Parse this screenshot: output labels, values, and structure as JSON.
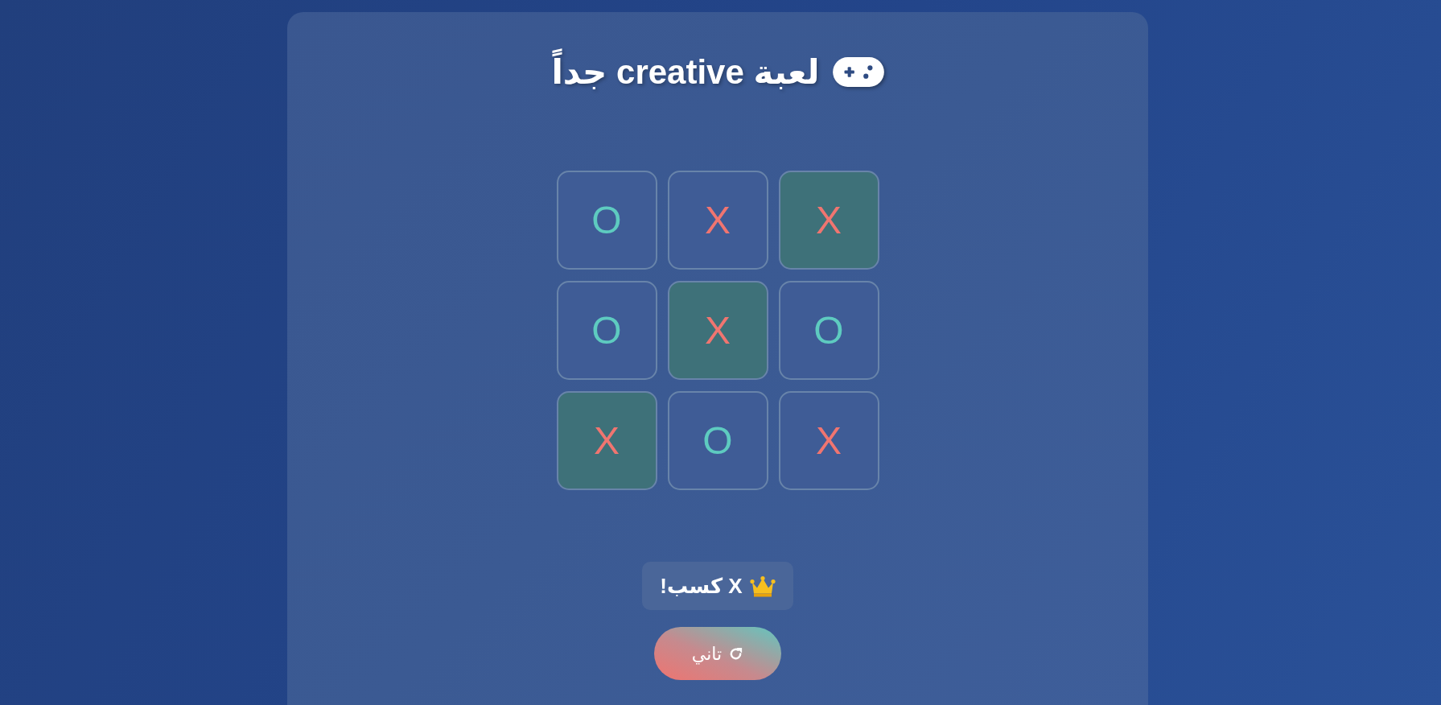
{
  "title": {
    "text": "لعبة creative جداً"
  },
  "board": {
    "cells": [
      {
        "kind": "x",
        "mark": "X",
        "winning": true
      },
      {
        "kind": "x",
        "mark": "X",
        "winning": false
      },
      {
        "kind": "o",
        "mark": "O",
        "winning": false
      },
      {
        "kind": "o",
        "mark": "O",
        "winning": false
      },
      {
        "kind": "x",
        "mark": "X",
        "winning": true
      },
      {
        "kind": "o",
        "mark": "O",
        "winning": false
      },
      {
        "kind": "x",
        "mark": "X",
        "winning": false
      },
      {
        "kind": "o",
        "mark": "O",
        "winning": false
      },
      {
        "kind": "x",
        "mark": "X",
        "winning": true
      }
    ]
  },
  "status": {
    "text": "X كسب!"
  },
  "restart_button": {
    "label": "تاني"
  }
}
